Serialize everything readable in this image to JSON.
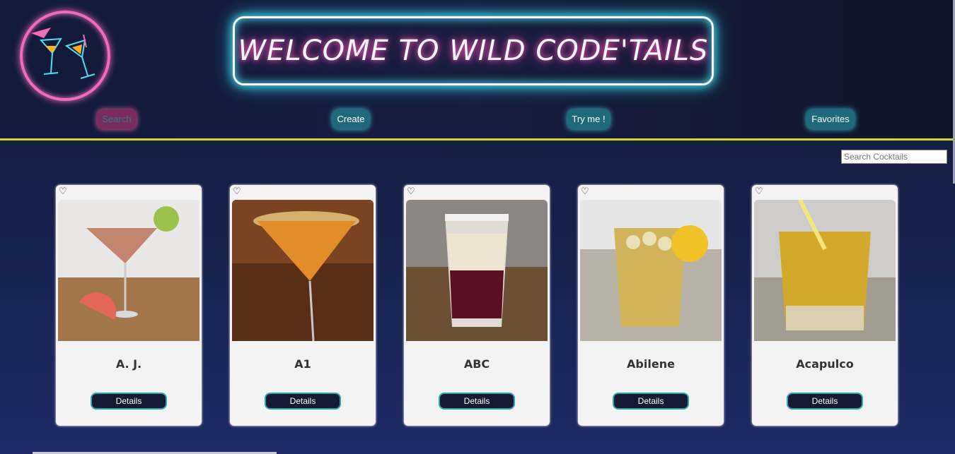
{
  "header": {
    "title": "WELCOME TO WILD CODE'TAILS",
    "logo": "cocktail-glasses-logo",
    "accent_pink": "#f06cb8",
    "accent_cyan": "#4fe0f0"
  },
  "nav": {
    "items": [
      {
        "label": "Search",
        "active": true
      },
      {
        "label": "Create",
        "active": false
      },
      {
        "label": "Try me !",
        "active": false
      },
      {
        "label": "Favorites",
        "active": false
      }
    ]
  },
  "search": {
    "placeholder": "Search Cocktails",
    "value": ""
  },
  "cocktails": [
    {
      "name": "A. J.",
      "details_label": "Details",
      "favorite_icon": "heart-outline-icon"
    },
    {
      "name": "A1",
      "details_label": "Details",
      "favorite_icon": "heart-outline-icon"
    },
    {
      "name": "ABC",
      "details_label": "Details",
      "favorite_icon": "heart-outline-icon"
    },
    {
      "name": "Abilene",
      "details_label": "Details",
      "favorite_icon": "heart-outline-icon"
    },
    {
      "name": "Acapulco",
      "details_label": "Details",
      "favorite_icon": "heart-outline-icon"
    }
  ]
}
